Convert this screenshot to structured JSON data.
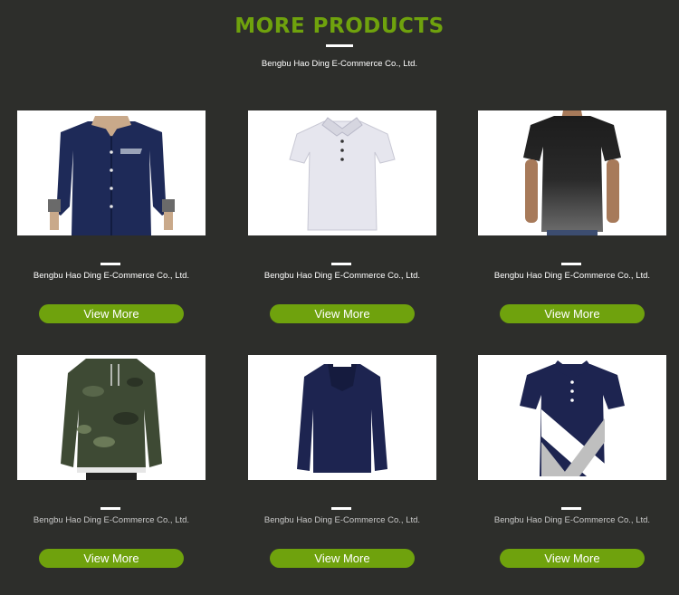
{
  "header": {
    "title": "MORE PRODUCTS",
    "subtitle": "Bengbu Hao Ding E-Commerce Co., Ltd."
  },
  "colors": {
    "background": "#2d2e2b",
    "accent": "#6fa20d",
    "text": "#ffffff"
  },
  "products": [
    {
      "image": "navy-long-sleeve-dress-shirt",
      "caption": "Bengbu Hao Ding E-Commerce Co., Ltd.",
      "button": "View More"
    },
    {
      "image": "white-polo-shirt",
      "caption": "Bengbu Hao Ding E-Commerce Co., Ltd.",
      "button": "View More"
    },
    {
      "image": "black-gradient-t-shirt",
      "caption": "Bengbu Hao Ding E-Commerce Co., Ltd.",
      "button": "View More"
    },
    {
      "image": "camo-hoodie",
      "caption": "Bengbu Hao Ding E-Commerce Co., Ltd.",
      "button": "View More"
    },
    {
      "image": "navy-hoodie",
      "caption": "Bengbu Hao Ding E-Commerce Co., Ltd.",
      "button": "View More"
    },
    {
      "image": "colorblock-polo-shirt",
      "caption": "Bengbu Hao Ding E-Commerce Co., Ltd.",
      "button": "View More"
    }
  ]
}
